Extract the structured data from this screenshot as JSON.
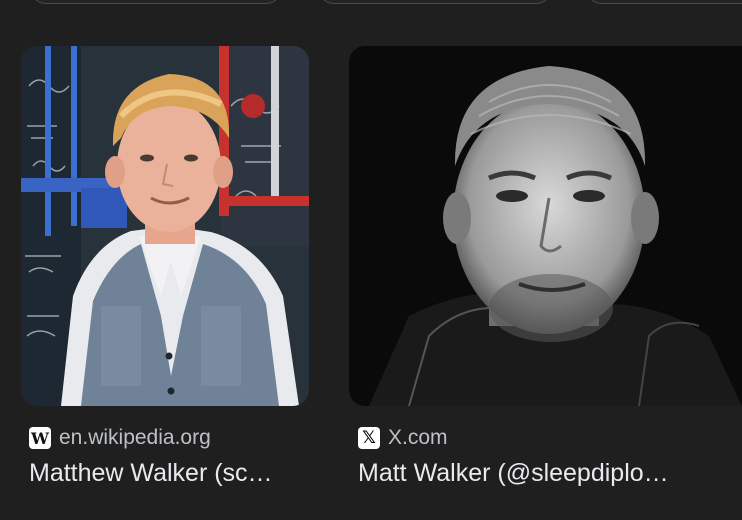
{
  "results": [
    {
      "source": "en.wikipedia.org",
      "favicon": "wikipedia-icon",
      "title": "Matthew Walker (sc…"
    },
    {
      "source": "X.com",
      "favicon": "x-icon",
      "title": "Matt Walker (@sleepdiplo…"
    }
  ],
  "favicon_glyphs": {
    "wiki": "W",
    "x": "𝕏"
  },
  "colors": {
    "background": "#1f1f1f",
    "source_text": "#bdc1c6",
    "title_text": "#e8eaed"
  }
}
